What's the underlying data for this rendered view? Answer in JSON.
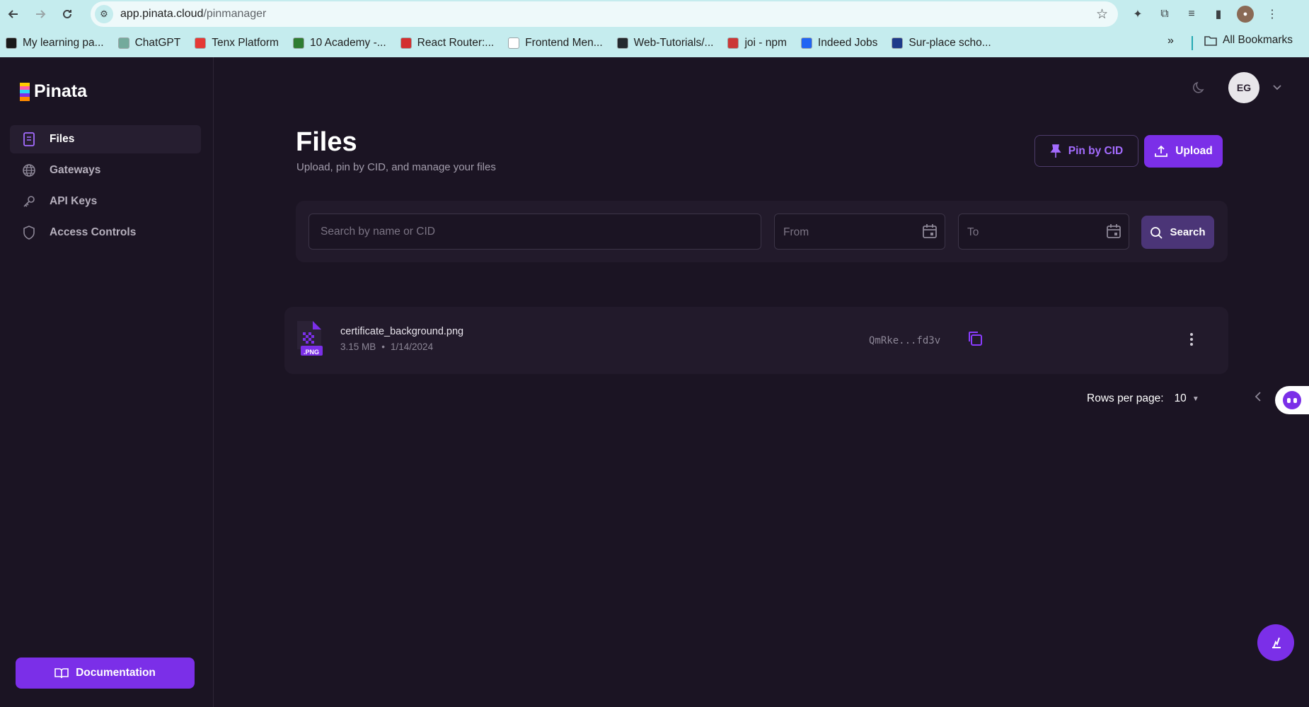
{
  "browser": {
    "url_host": "app.pinata.cloud",
    "url_path": "/pinmanager",
    "bookmarks": [
      {
        "label": "My learning pa...",
        "color": "#1a1a1a"
      },
      {
        "label": "ChatGPT",
        "color": "#74aa9c"
      },
      {
        "label": "Tenx Platform",
        "color": "#e53935"
      },
      {
        "label": "10 Academy -...",
        "color": "#2e7d32"
      },
      {
        "label": "React Router:...",
        "color": "#d32f2f"
      },
      {
        "label": "Frontend Men...",
        "color": "#ffffff"
      },
      {
        "label": "Web-Tutorials/...",
        "color": "#24292e"
      },
      {
        "label": "joi - npm",
        "color": "#cb3837"
      },
      {
        "label": "Indeed Jobs",
        "color": "#2164f3"
      },
      {
        "label": "Sur-place scho...",
        "color": "#1e3a8a"
      }
    ],
    "more": "»",
    "all_bookmarks": "All Bookmarks",
    "profile_initials": ""
  },
  "sidebar": {
    "brand": "Pinata",
    "items": [
      {
        "label": "Files",
        "icon": "file-icon",
        "active": true
      },
      {
        "label": "Gateways",
        "icon": "globe-icon",
        "active": false
      },
      {
        "label": "API Keys",
        "icon": "key-icon",
        "active": false
      },
      {
        "label": "Access Controls",
        "icon": "shield-icon",
        "active": false
      }
    ],
    "documentation_label": "Documentation"
  },
  "header": {
    "avatar_initials": "EG"
  },
  "main": {
    "title": "Files",
    "subtitle": "Upload, pin by CID, and manage your files",
    "pin_by_cid_label": "Pin by CID",
    "upload_label": "Upload",
    "search": {
      "placeholder": "Search by name or CID",
      "from_placeholder": "From",
      "to_placeholder": "To",
      "button_label": "Search"
    },
    "files": [
      {
        "name": "certificate_background.png",
        "size": "3.15 MB",
        "date": "1/14/2024",
        "type_badge": ".PNG",
        "cid": "QmRke...fd3v"
      }
    ],
    "pagination": {
      "rows_label": "Rows per page:",
      "rows_value": "10"
    }
  },
  "colors": {
    "accent": "#7b2fe8",
    "background": "#1b1423",
    "panel": "#221a2b"
  }
}
